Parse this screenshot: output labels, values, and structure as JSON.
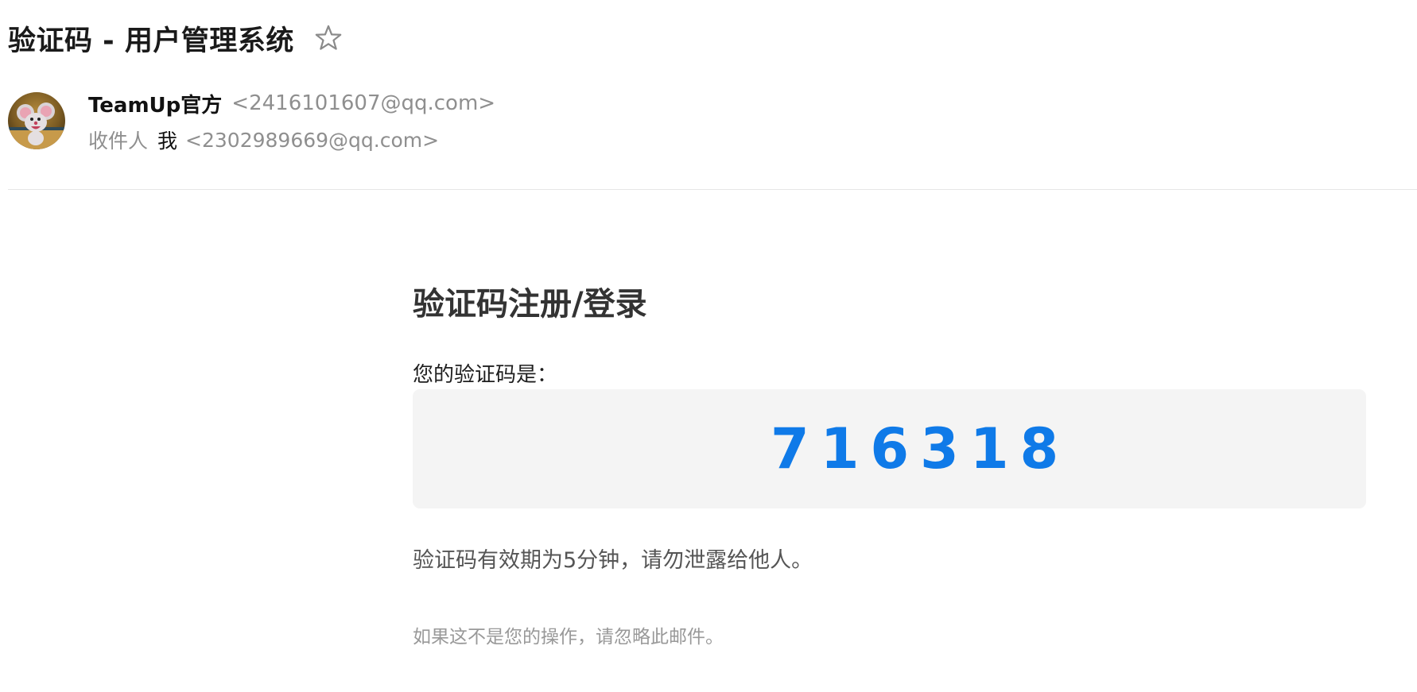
{
  "mail": {
    "subject": "验证码 - 用户管理系统",
    "star_icon": "star-outline-icon",
    "sender": {
      "name": "TeamUp官方",
      "email": "<2416101607@qq.com>",
      "avatar_icon": "cartoon-mouse-avatar"
    },
    "recipient": {
      "label": "收件人",
      "name": "我",
      "email": "<2302989669@qq.com>"
    }
  },
  "content": {
    "title": "验证码注册/登录",
    "code_label": "您的验证码是：",
    "code": "716318",
    "validity_note": "验证码有效期为5分钟，请勿泄露给他人。",
    "ignore_note": "如果这不是您的操作，请忽略此邮件。"
  },
  "colors": {
    "code_color": "#0f7ae8",
    "code_box_bg": "#f4f4f4",
    "muted_text": "#8f8f8f"
  }
}
